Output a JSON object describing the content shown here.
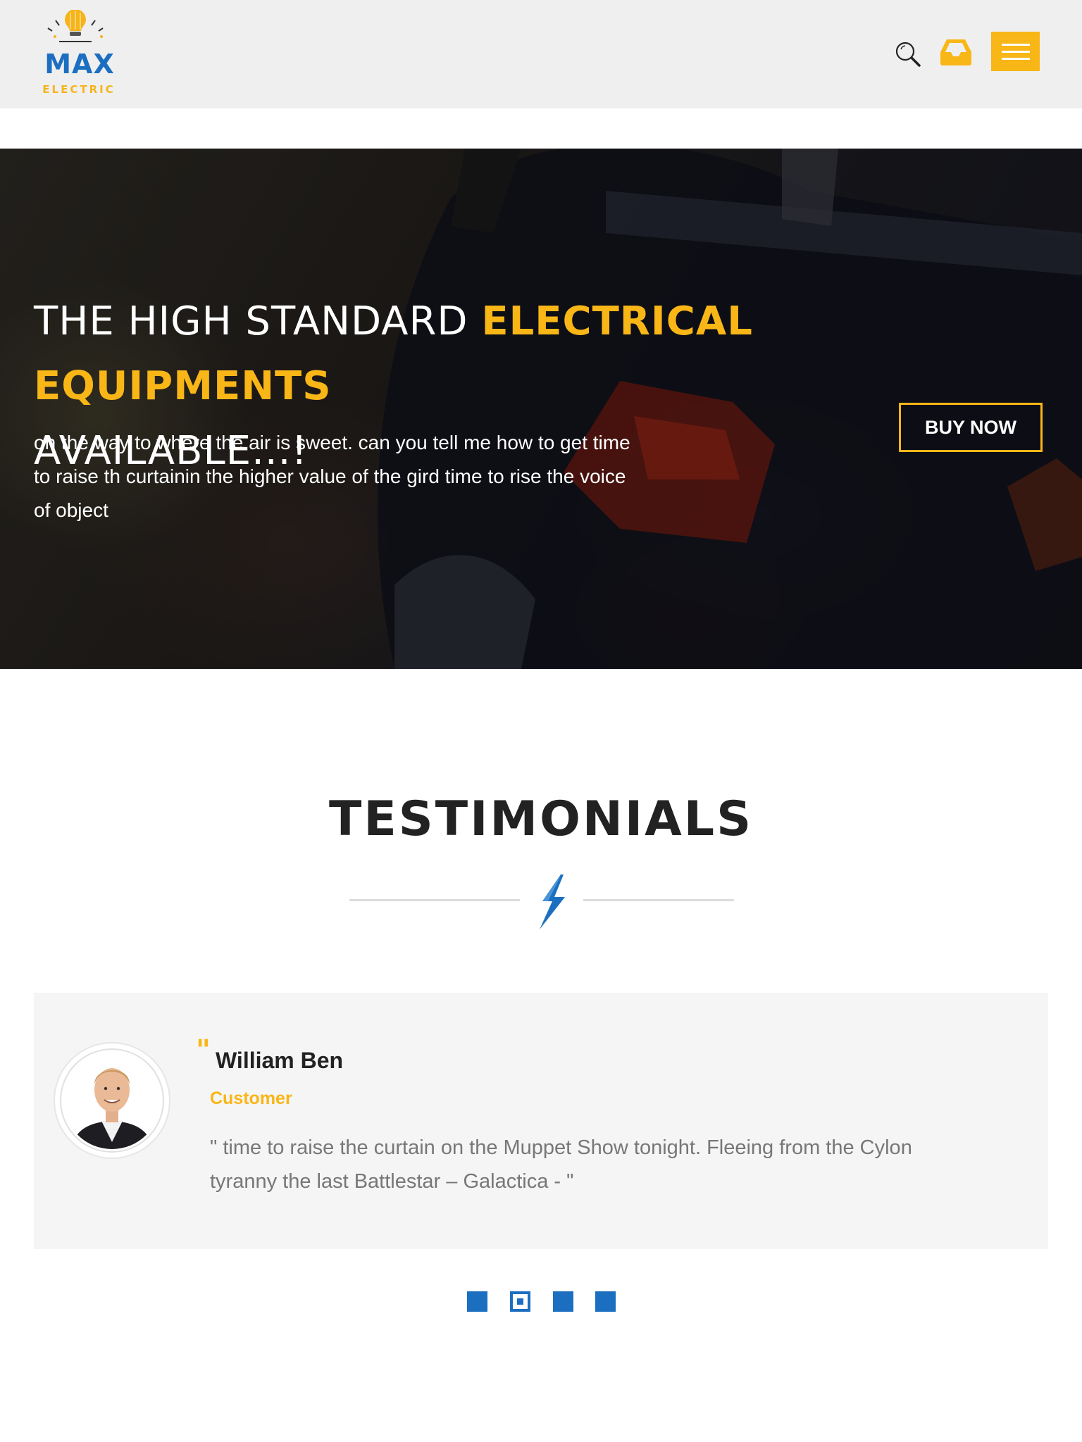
{
  "header": {
    "logo_word": "MAX",
    "logo_subword": "ELECTRIC",
    "search_icon": "search-icon",
    "inbox_icon": "inbox-icon",
    "menu_icon": "hamburger-menu-icon"
  },
  "hero": {
    "title_part1": "THE HIGH STANDARD ",
    "title_highlight": "ELECTRICAL EQUIPMENTS",
    "title_part2": "AVAILABLE...!",
    "text": "on the way to where the air is sweet. can you tell me how to get time to raise th curtainin the higher value of the gird time to rise the voice of object",
    "cta_label": "BUY NOW"
  },
  "testimonials": {
    "title": "TESTIMONIALS",
    "divider_icon": "lightning-bolt-icon",
    "quote_mark": "\"",
    "name": "William Ben",
    "role": "Customer",
    "quote": "\" time to raise the curtain on the Muppet Show tonight. Fleeing from the Cylon tyranny the last Battlestar – Galactica - \"",
    "active_dot": 2,
    "dot_count": 4
  },
  "colors": {
    "accent": "#f9b617",
    "brand_blue": "#1c6fc0",
    "header_bg": "#efefef",
    "card_bg": "#f5f5f5"
  }
}
